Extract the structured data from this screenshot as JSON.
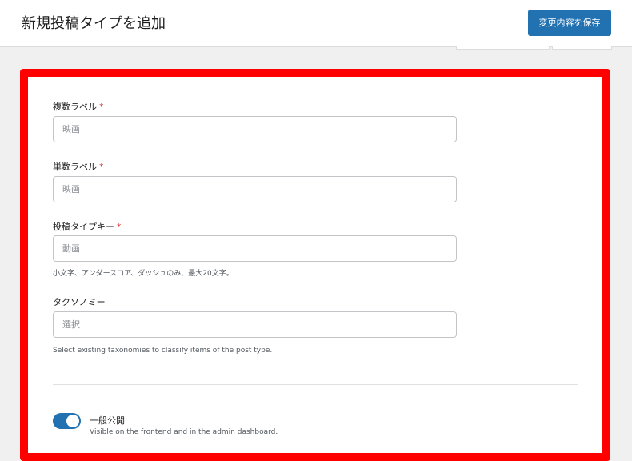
{
  "header": {
    "title": "新規投稿タイプを追加",
    "save_label": "変更内容を保存"
  },
  "form": {
    "plural_label": {
      "label": "複数ラベル",
      "required": "*",
      "placeholder": "映画"
    },
    "singular_label": {
      "label": "単数ラベル",
      "required": "*",
      "placeholder": "映画"
    },
    "post_type_key": {
      "label": "投稿タイプキー",
      "required": "*",
      "placeholder": "動画",
      "help": "小文字、アンダースコア、ダッシュのみ、最大20文字。"
    },
    "taxonomies": {
      "label": "タクソノミー",
      "placeholder": "選択",
      "help": "Select existing taxonomies to classify items of the post type."
    },
    "public_toggle": {
      "label": "一般公開",
      "help": "Visible on the frontend and in the admin dashboard.",
      "on": true
    }
  },
  "colors": {
    "accent": "#2271b1",
    "highlight_border": "#ff0000",
    "required": "#d63638"
  }
}
